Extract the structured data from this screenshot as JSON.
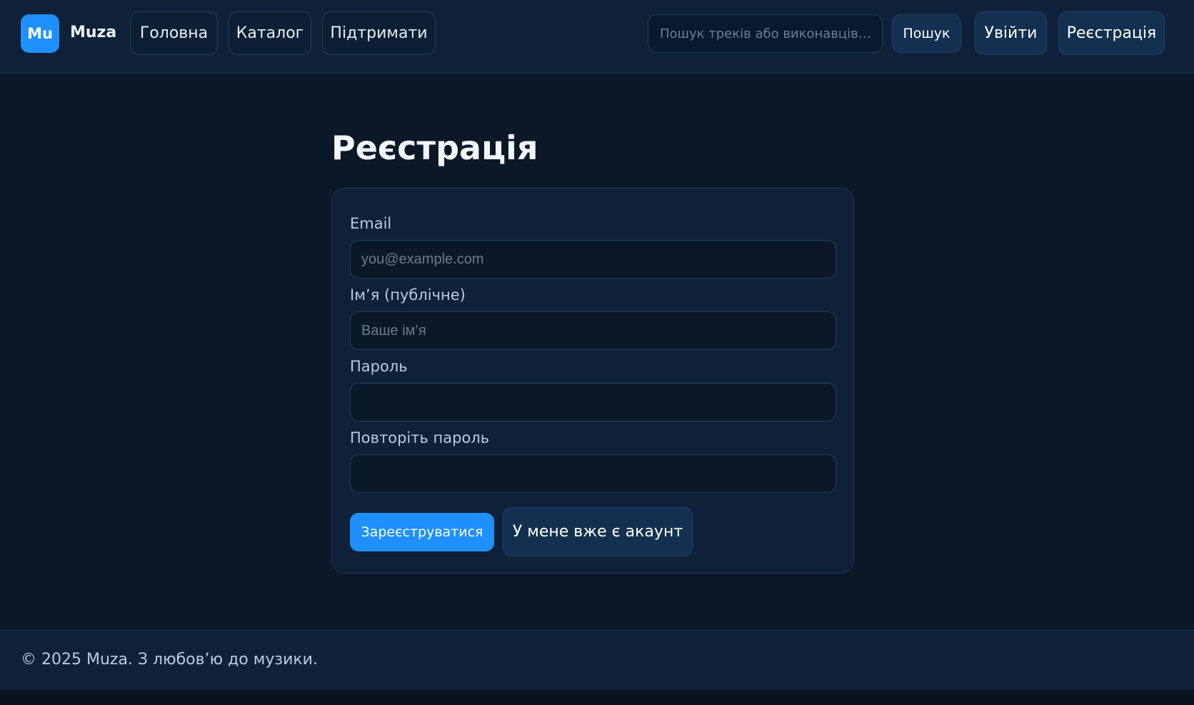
{
  "header": {
    "logo_badge": "Mu",
    "brand": "Muza",
    "nav": {
      "home": "Головна",
      "catalog": "Каталог",
      "support": "Підтримати"
    },
    "search": {
      "placeholder": "Пошук треків або виконавців…",
      "button": "Пошук"
    },
    "login": "Увійти",
    "register": "Реєстрація"
  },
  "main": {
    "title": "Реєстрація",
    "form": {
      "email": {
        "label": "Email",
        "placeholder": "you@example.com"
      },
      "name": {
        "label": "Ім’я (публічне)",
        "placeholder": "Ваше ім’я"
      },
      "password": {
        "label": "Пароль"
      },
      "password_repeat": {
        "label": "Повторіть пароль"
      },
      "submit": "Зареєструватися",
      "have_account": "У мене вже є акаунт"
    }
  },
  "footer": {
    "text": "© 2025 Muza. З любов’ю до музики."
  },
  "colors": {
    "accent": "#1e90ff",
    "background": "#0a1828",
    "panel": "#0f2139"
  }
}
